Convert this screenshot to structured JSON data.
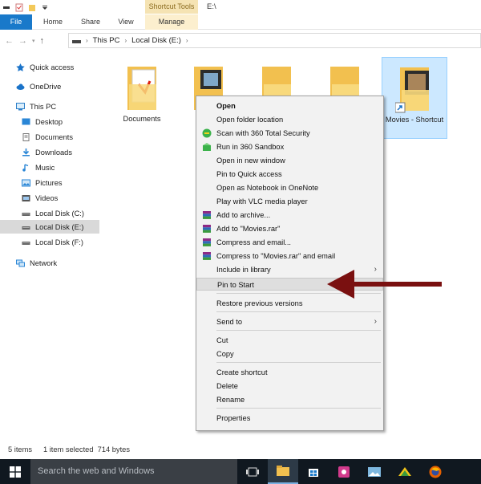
{
  "window": {
    "contextual_tab_header": "Shortcut Tools",
    "path_title": "E:\\"
  },
  "ribbon": {
    "tabs": [
      "File",
      "Home",
      "Share",
      "View",
      "Manage"
    ]
  },
  "address": {
    "segments": [
      "This PC",
      "Local Disk (E:)"
    ]
  },
  "nav_pane": {
    "items": [
      {
        "label": "Quick access",
        "icon": "star-icon"
      },
      {
        "label": "OneDrive",
        "icon": "cloud-icon"
      },
      {
        "label": "This PC",
        "icon": "computer-icon"
      },
      {
        "label": "Desktop",
        "icon": "desktop-icon"
      },
      {
        "label": "Documents",
        "icon": "documents-icon"
      },
      {
        "label": "Downloads",
        "icon": "download-icon"
      },
      {
        "label": "Music",
        "icon": "music-icon"
      },
      {
        "label": "Pictures",
        "icon": "pictures-icon"
      },
      {
        "label": "Videos",
        "icon": "videos-icon"
      },
      {
        "label": "Local Disk (C:)",
        "icon": "drive-icon"
      },
      {
        "label": "Local Disk (E:)",
        "icon": "drive-icon",
        "selected": true
      },
      {
        "label": "Local Disk (F:)",
        "icon": "drive-icon"
      },
      {
        "label": "Network",
        "icon": "network-icon"
      }
    ]
  },
  "files": [
    {
      "name": "Documents"
    },
    {
      "name": ""
    },
    {
      "name": ""
    },
    {
      "name": ""
    },
    {
      "name": "Movies - Shortcut",
      "selected": true
    }
  ],
  "context_menu": {
    "items": [
      {
        "label": "Open",
        "bold": true
      },
      {
        "label": "Open folder location"
      },
      {
        "label": "Scan with 360 Total Security",
        "icon": "360-scan-icon"
      },
      {
        "label": "Run in 360 Sandbox",
        "icon": "sandbox-icon"
      },
      {
        "label": "Open in new window"
      },
      {
        "label": "Pin to Quick access"
      },
      {
        "label": "Open as Notebook in OneNote"
      },
      {
        "label": "Play with VLC media player"
      },
      {
        "label": "Add to archive...",
        "icon": "winrar-icon"
      },
      {
        "label": "Add to \"Movies.rar\"",
        "icon": "winrar-icon"
      },
      {
        "label": "Compress and email...",
        "icon": "winrar-icon"
      },
      {
        "label": "Compress to \"Movies.rar\" and email",
        "icon": "winrar-icon"
      },
      {
        "label": "Include in library",
        "submenu": true
      },
      {
        "label": "Pin to Start",
        "highlighted": true
      },
      {
        "label": "Restore previous versions"
      },
      {
        "label": "Send to",
        "submenu": true
      },
      {
        "label": "Cut"
      },
      {
        "label": "Copy"
      },
      {
        "label": "Create shortcut"
      },
      {
        "label": "Delete"
      },
      {
        "label": "Rename"
      },
      {
        "label": "Properties"
      }
    ]
  },
  "status": {
    "count": "5 items",
    "selection": "1 item selected  714 bytes"
  },
  "taskbar": {
    "search_placeholder": "Search the web and Windows"
  },
  "colors": {
    "accent": "#1979ca",
    "annotation_arrow": "#7a1010",
    "taskbar": "#101820"
  }
}
